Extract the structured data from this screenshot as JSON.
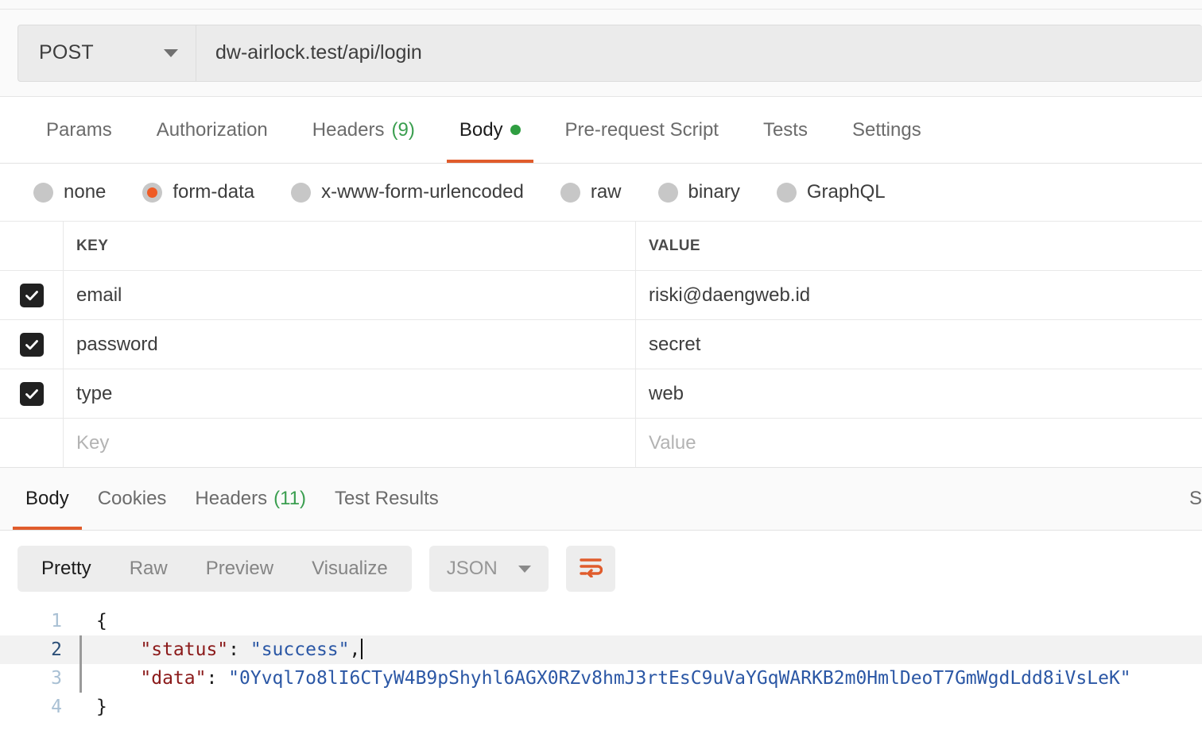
{
  "request": {
    "method": "POST",
    "url": "dw-airlock.test/api/login",
    "tabs": [
      {
        "label": "Params",
        "active": false
      },
      {
        "label": "Authorization",
        "active": false
      },
      {
        "label": "Headers",
        "count": "(9)",
        "active": false
      },
      {
        "label": "Body",
        "active": true,
        "has_dot": true
      },
      {
        "label": "Pre-request Script",
        "active": false
      },
      {
        "label": "Tests",
        "active": false
      },
      {
        "label": "Settings",
        "active": false
      }
    ],
    "body_types": [
      {
        "label": "none",
        "selected": false
      },
      {
        "label": "form-data",
        "selected": true
      },
      {
        "label": "x-www-form-urlencoded",
        "selected": false
      },
      {
        "label": "raw",
        "selected": false
      },
      {
        "label": "binary",
        "selected": false
      },
      {
        "label": "GraphQL",
        "selected": false
      }
    ],
    "table": {
      "headers": {
        "key": "KEY",
        "value": "VALUE"
      },
      "rows": [
        {
          "checked": true,
          "key": "email",
          "value": "riski@daengweb.id"
        },
        {
          "checked": true,
          "key": "password",
          "value": "secret"
        },
        {
          "checked": true,
          "key": "type",
          "value": "web"
        }
      ],
      "empty_row": {
        "key_placeholder": "Key",
        "value_placeholder": "Value"
      }
    }
  },
  "response": {
    "tabs": [
      {
        "label": "Body",
        "active": true
      },
      {
        "label": "Cookies",
        "active": false
      },
      {
        "label": "Headers",
        "count": "(11)",
        "active": false
      },
      {
        "label": "Test Results",
        "active": false
      }
    ],
    "status_partial": "S",
    "view_modes": [
      {
        "label": "Pretty",
        "active": true
      },
      {
        "label": "Raw",
        "active": false
      },
      {
        "label": "Preview",
        "active": false
      },
      {
        "label": "Visualize",
        "active": false
      }
    ],
    "format": "JSON",
    "wrap_icon": "word-wrap-icon",
    "code": {
      "lines": [
        {
          "num": "1",
          "active": false,
          "fold": false,
          "parts": [
            {
              "t": "punc",
              "v": "{"
            }
          ]
        },
        {
          "num": "2",
          "active": true,
          "fold": true,
          "indent": true,
          "caret": true,
          "parts": [
            {
              "t": "key",
              "v": "\"status\""
            },
            {
              "t": "punc",
              "v": ": "
            },
            {
              "t": "str",
              "v": "\"success\""
            },
            {
              "t": "punc",
              "v": ","
            }
          ]
        },
        {
          "num": "3",
          "active": false,
          "fold": true,
          "indent": true,
          "parts": [
            {
              "t": "key",
              "v": "\"data\""
            },
            {
              "t": "punc",
              "v": ": "
            },
            {
              "t": "str",
              "v": "\"0Yvql7o8lI6CTyW4B9pShyhl6AGX0RZv8hmJ3rtEsC9uVaYGqWARKB2m0HmlDeoT7GmWgdLdd8iVsLeK\""
            }
          ]
        },
        {
          "num": "4",
          "active": false,
          "fold": false,
          "parts": [
            {
              "t": "punc",
              "v": "}"
            }
          ]
        }
      ]
    }
  },
  "colors": {
    "accent_orange": "#e05c2c",
    "radio_orange": "#ef5b25",
    "green": "#2f9e41",
    "json_key": "#8b1a1a",
    "json_string": "#2b57a5"
  }
}
